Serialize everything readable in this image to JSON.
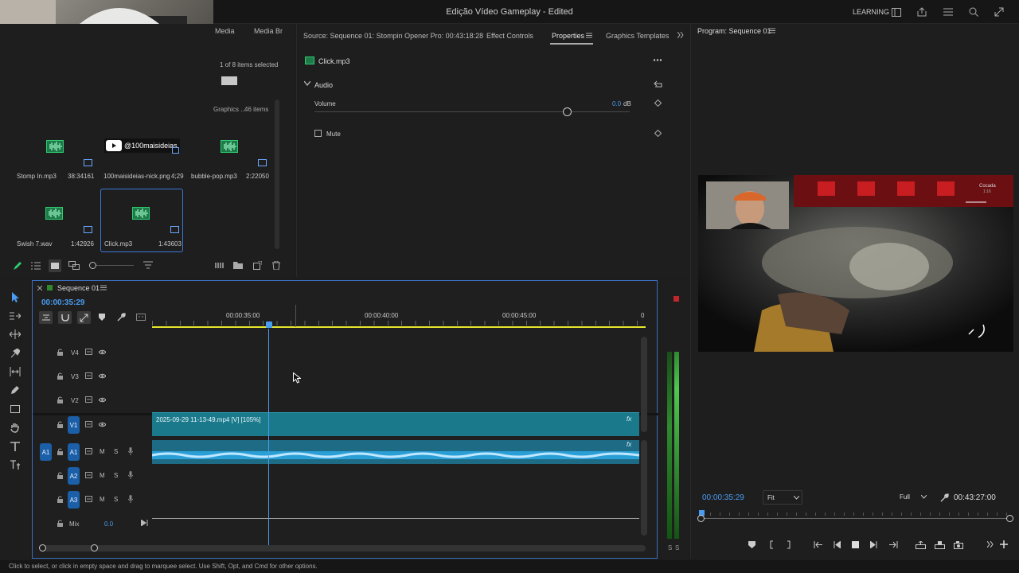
{
  "app": {
    "title": "Edição Vídeo Gameplay - Edited",
    "workspace_label": "LEARNING"
  },
  "project_panel": {
    "tabs": [
      "Media",
      "Media Br"
    ],
    "selection_status": "1 of 8 items selected",
    "bin_name": "Graphics ...",
    "bin_count": "46 items",
    "items": [
      {
        "name": "Stomp In.mp3",
        "duration": "38:34161",
        "kind": "audio",
        "selected": false
      },
      {
        "name": "100maisideias-nick.png",
        "duration": "4;29",
        "kind": "image",
        "overlay_text": "@100maisideias",
        "selected": false
      },
      {
        "name": "bubble-pop.mp3",
        "duration": "2:22050",
        "kind": "audio",
        "selected": false
      },
      {
        "name": "Swish 7.wav",
        "duration": "1:42926",
        "kind": "audio",
        "selected": false
      },
      {
        "name": "Click.mp3",
        "duration": "1:43603",
        "kind": "audio",
        "selected": true
      }
    ]
  },
  "source_panel": {
    "source_tab": "Source: Sequence 01: Stompin Opener Pro: 00:43:18:28",
    "effect_controls_tab": "Effect Controls",
    "properties_tab": "Properties",
    "graphics_templates_tab": "Graphics Templates",
    "clip_name": "Click.mp3",
    "section_audio": "Audio",
    "volume_label": "Volume",
    "volume_value": "0.0",
    "volume_unit": "dB",
    "volume_fraction": 0.8,
    "mute_label": "Mute",
    "mute_checked": false
  },
  "program_monitor": {
    "tab": "Program: Sequence 01",
    "timecode": "00:00:35:29",
    "fit_option": "Fit",
    "quality_option": "Full",
    "duration": "00:43:27:00",
    "hud_label": "Cocada",
    "hud_sublabel": "1:16"
  },
  "timeline": {
    "sequence_name": "Sequence 01",
    "timecode": "00:00:35:29",
    "ruler_labels": [
      "00:00:35:00",
      "00:00:40:00",
      "00:00:45:00",
      "0"
    ],
    "tracks": {
      "video": [
        "V4",
        "V3",
        "V2",
        "V1"
      ],
      "audio": [
        "A1",
        "A2",
        "A3"
      ],
      "source_patch": "A1",
      "mix_label": "Mix",
      "mix_value": "0.0",
      "m_label": "M",
      "s_label": "S"
    },
    "video_clip_label": "2025-09-29 11-13-49.mp4 [V] [105%]",
    "fx_label": "fx"
  },
  "meters": {
    "labels": [
      "S",
      "S"
    ]
  },
  "status_bar": {
    "text": "Click to select, or click in empty space and drag to marquee select. Use Shift, Opt, and Cmd for other options."
  },
  "colors": {
    "accent_blue": "#2f80ed",
    "clip_video": "#1a7a8c",
    "clip_audio": "#2a9fd6",
    "audio_icon_green": "#2ecc71",
    "playhead_blue": "#4a9cf0",
    "ruler_yellow": "#e6e62d"
  }
}
